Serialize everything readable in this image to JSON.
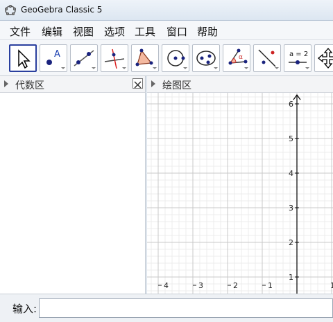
{
  "window": {
    "title": "GeoGebra Classic 5"
  },
  "menu": [
    "文件",
    "编辑",
    "视图",
    "选项",
    "工具",
    "窗口",
    "帮助"
  ],
  "tools": [
    {
      "name": "move-tool"
    },
    {
      "name": "point-tool"
    },
    {
      "name": "line-tool"
    },
    {
      "name": "perpendicular-tool"
    },
    {
      "name": "polygon-tool"
    },
    {
      "name": "circle-tool"
    },
    {
      "name": "ellipse-tool"
    },
    {
      "name": "angle-tool"
    },
    {
      "name": "reflect-tool"
    },
    {
      "name": "slider-tool",
      "label": "a = 2"
    },
    {
      "name": "move-graphics-tool"
    }
  ],
  "algebra": {
    "title": "代数区"
  },
  "graphics": {
    "title": "绘图区",
    "y_ticks": [
      "6",
      "5",
      "4",
      "3",
      "2",
      "1"
    ],
    "x_ticks": [
      "4",
      "3",
      "2",
      "1",
      "1"
    ]
  },
  "input": {
    "label": "输入:"
  },
  "colors": {
    "accent": "#2a3f9e",
    "grid_major": "#c8c8c8",
    "grid_minor": "#ececec",
    "point": "#1a237e"
  }
}
